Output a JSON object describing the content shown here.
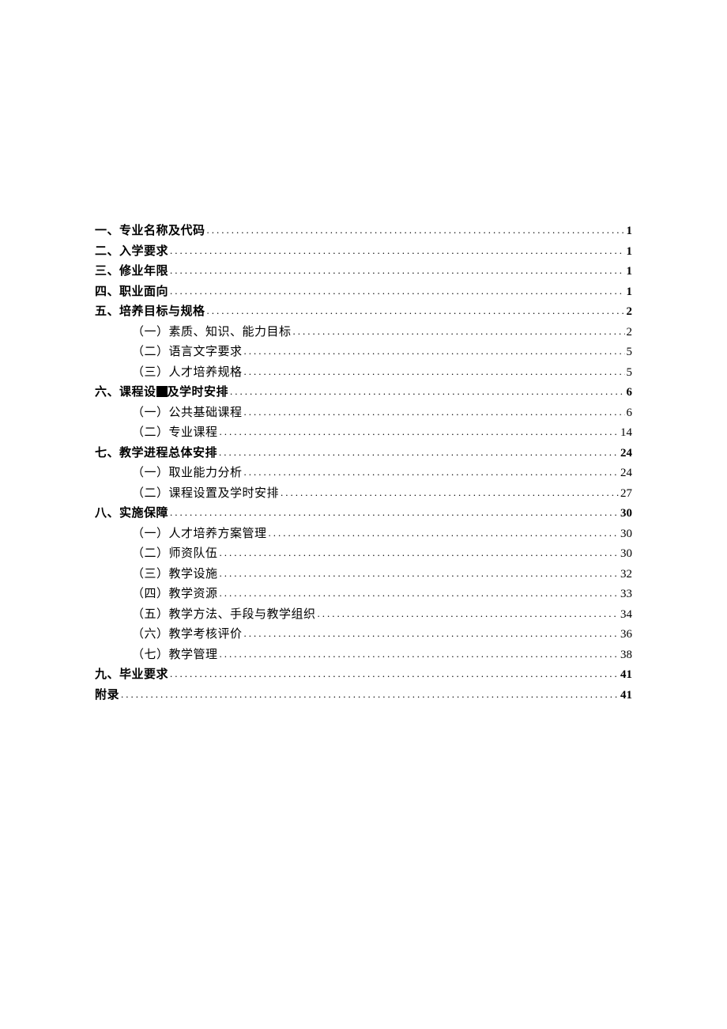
{
  "toc": [
    {
      "label": "一、专业名称及代码",
      "page": "1",
      "level": 0,
      "bold": true
    },
    {
      "label": "二、入学要求",
      "page": "1",
      "level": 0,
      "bold": true
    },
    {
      "label": "三、修业年限",
      "page": "1",
      "level": 0,
      "bold": true
    },
    {
      "label": "四、职业面向",
      "page": "1",
      "level": 0,
      "bold": true
    },
    {
      "label": "五、培养目标与规格",
      "page": "2",
      "level": 0,
      "bold": true
    },
    {
      "label": "（一）素质、知识、能力目标",
      "page": "2",
      "level": 1,
      "bold": false
    },
    {
      "label": "（二）语言文字要求",
      "page": "5",
      "level": 1,
      "bold": false
    },
    {
      "label": "（三）人才培养规格",
      "page": "5",
      "level": 1,
      "bold": false
    },
    {
      "label_pre": "六、课程设",
      "label_post": "及学时安排",
      "page": "6",
      "level": 0,
      "bold": true,
      "has_square": true
    },
    {
      "label": "（一）公共基础课程",
      "page": "6",
      "level": 1,
      "bold": false
    },
    {
      "label": "（二）专业课程",
      "page": "14",
      "level": 1,
      "bold": false
    },
    {
      "label": "七、教学进程总体安排",
      "page": "24",
      "level": 0,
      "bold": true
    },
    {
      "label": "（一）取业能力分析",
      "page": "24",
      "level": 1,
      "bold": false
    },
    {
      "label": "（二）课程设置及学时安排",
      "page": "27",
      "level": 1,
      "bold": false
    },
    {
      "label": "八、实施保障",
      "page": "30",
      "level": 0,
      "bold": true
    },
    {
      "label": "（一）人才培养方案管理",
      "page": "30",
      "level": 1,
      "bold": false
    },
    {
      "label": "（二）师资队伍",
      "page": "30",
      "level": 1,
      "bold": false
    },
    {
      "label": "（三）教学设施",
      "page": "32",
      "level": 1,
      "bold": false
    },
    {
      "label": "（四）教学资源",
      "page": "33",
      "level": 1,
      "bold": false
    },
    {
      "label": "（五）教学方法、手段与教学组织",
      "page": "34",
      "level": 1,
      "bold": false
    },
    {
      "label": "（六）教学考核评价",
      "page": "36",
      "level": 1,
      "bold": false
    },
    {
      "label": "（七）教学管理",
      "page": "38",
      "level": 1,
      "bold": false
    },
    {
      "label": "九、毕业要求",
      "page": "41",
      "level": 0,
      "bold": true
    },
    {
      "label": "附录",
      "page": "41",
      "level": 0,
      "bold": true
    }
  ],
  "dots": "........................................................................................................................................"
}
